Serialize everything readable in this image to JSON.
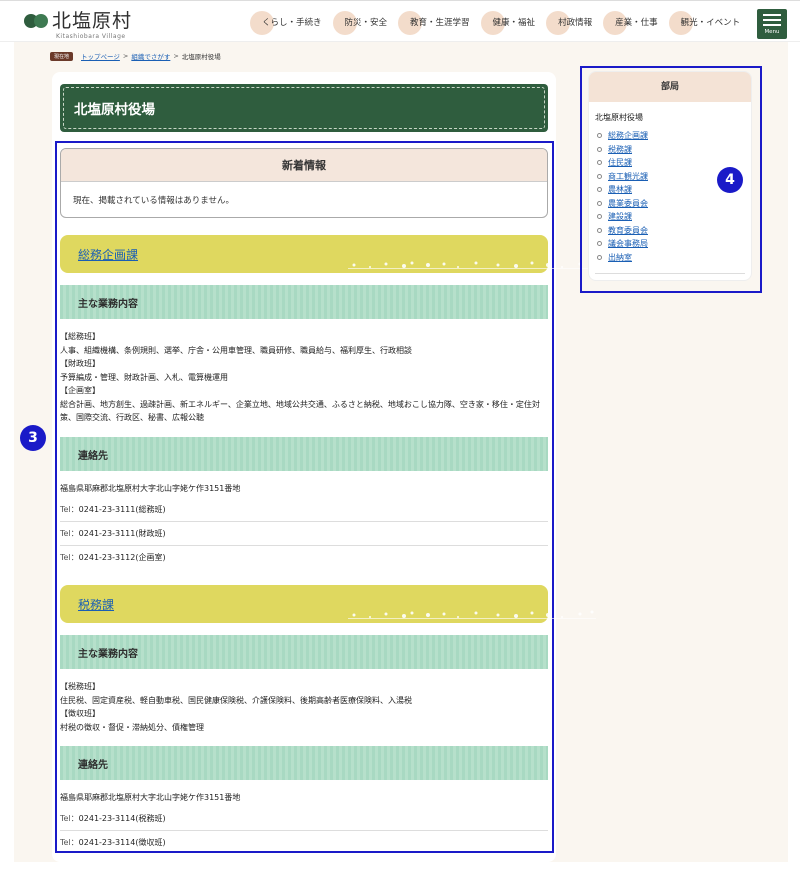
{
  "header": {
    "logo_text": "北塩原村",
    "logo_sub": "Kitashiobara Village",
    "nav": [
      "くらし・手続き",
      "防災・安全",
      "教育・生涯学習",
      "健康・福祉",
      "村政情報",
      "産業・仕事",
      "観光・イベント"
    ],
    "menu_label": "Menu"
  },
  "breadcrumb": {
    "badge": "現在地",
    "items": [
      "トップページ",
      "組織でさがす",
      "北塩原村役場"
    ]
  },
  "page_title": "北塩原村役場",
  "annotations": {
    "main": "3",
    "side": "4"
  },
  "news": {
    "title": "新着情報",
    "body": "現在、掲載されている情報はありません。"
  },
  "departments": [
    {
      "name": "総務企画課",
      "duties_heading": "主な業務内容",
      "duties": [
        "【総務班】",
        "人事、組織機構、条例規則、選挙、庁舎・公用車管理、職員研修、職員給与、福利厚生、行政相談",
        "【財政班】",
        "予算編成・管理、財政計画、入札、電算機運用",
        "【企画室】",
        "総合計画、地方創生、過疎計画、新エネルギー、企業立地、地域公共交通、ふるさと納税、地域おこし協力隊、空き家・移住・定住対策、国際交流、行政区、秘書、広報公聴"
      ],
      "contact_heading": "連絡先",
      "address": "福島県耶麻郡北塩原村大字北山字姥ケ作3151番地",
      "tels": [
        {
          "prefix": "Tel：",
          "number": "0241-23-3111(総務班)"
        },
        {
          "prefix": "Tel：",
          "number": "0241-23-3111(財政班)"
        },
        {
          "prefix": "Tel：",
          "number": "0241-23-3112(企画室)"
        }
      ]
    },
    {
      "name": "税務課",
      "duties_heading": "主な業務内容",
      "duties": [
        "【税務班】",
        "住民税、固定資産税、軽自動車税、国民健康保険税、介護保険料、後期高齢者医療保険料、入湯税",
        "【徴収班】",
        "村税の徴収・督促・滞納処分、債権管理"
      ],
      "contact_heading": "連絡先",
      "address": "福島県耶麻郡北塩原村大字北山字姥ケ作3151番地",
      "tels": [
        {
          "prefix": "Tel：",
          "number": "0241-23-3114(税務班)"
        },
        {
          "prefix": "Tel：",
          "number": "0241-23-3114(徴収班)"
        }
      ]
    }
  ],
  "sidebar": {
    "title": "部局",
    "subtitle": "北塩原村役場",
    "items": [
      "総務企画課",
      "税務課",
      "住民課",
      "商工観光課",
      "農林課",
      "農業委員会",
      "建設課",
      "教育委員会",
      "議会事務局",
      "出納室"
    ]
  },
  "colors": {
    "header_green": "#2f5d3e",
    "dept_yellow": "#dfd85f",
    "section_mint": "#a8d9c2",
    "link_blue": "#1a5fb4",
    "annotation_blue": "#1a1ac8"
  }
}
